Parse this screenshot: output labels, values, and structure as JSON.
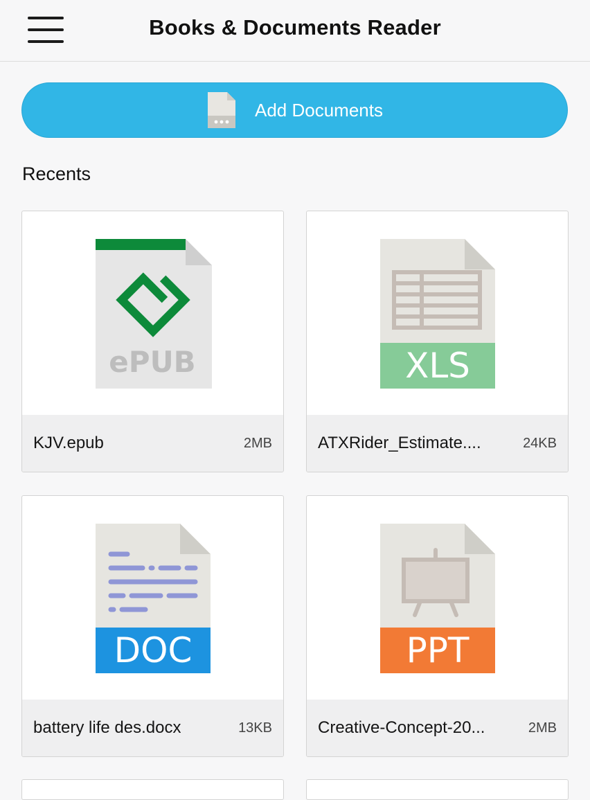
{
  "header": {
    "title": "Books & Documents Reader"
  },
  "add_button": {
    "label": "Add Documents"
  },
  "recents": {
    "heading": "Recents",
    "items": [
      {
        "name": "KJV.epub",
        "size": "2MB",
        "type": "epub",
        "badge": "ePUB",
        "icon": "epub-file-icon",
        "accent": "#0d8a3a"
      },
      {
        "name": "ATXRider_Estimate....",
        "size": "24KB",
        "type": "xls",
        "badge": "XLS",
        "icon": "xls-file-icon",
        "accent": "#86cb98"
      },
      {
        "name": "battery life des.docx",
        "size": "13KB",
        "type": "doc",
        "badge": "DOC",
        "icon": "doc-file-icon",
        "accent": "#1d93e0"
      },
      {
        "name": "Creative-Concept-20...",
        "size": "2MB",
        "type": "ppt",
        "badge": "PPT",
        "icon": "ppt-file-icon",
        "accent": "#f27a35"
      }
    ]
  },
  "colors": {
    "accent": "#31b6e6",
    "background": "#f7f7f8",
    "card_footer": "#efeff0"
  }
}
